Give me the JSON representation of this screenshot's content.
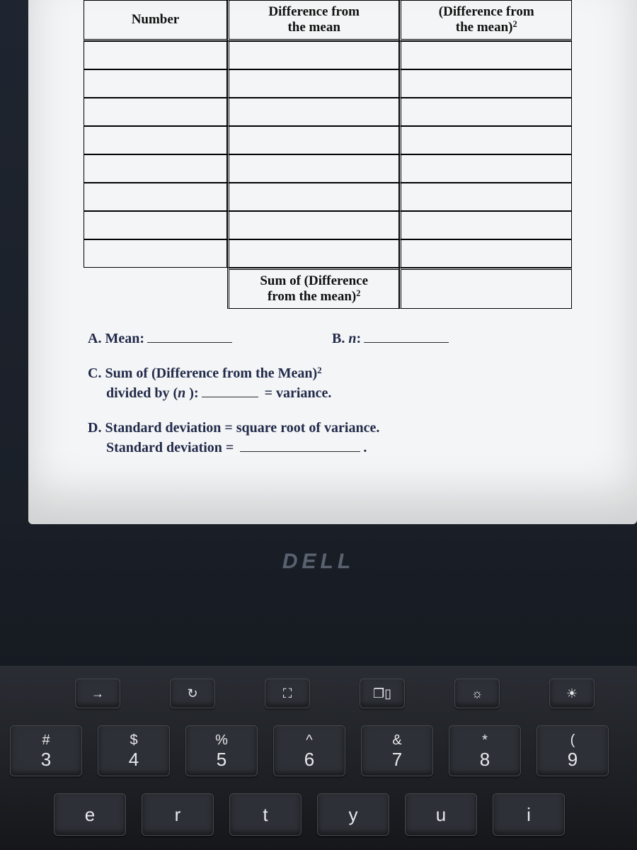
{
  "table": {
    "headers": {
      "number": "Number",
      "diff_line1": "Difference from",
      "diff_line2": "the mean",
      "sq_line1": "(Difference from",
      "sq_line2": "the mean)",
      "sq_sup": "2"
    },
    "row_count": 8,
    "sum_label_line1": "Sum of (Difference",
    "sum_label_line2": "from the mean)",
    "sum_label_sup": "2"
  },
  "prompts": {
    "a_label": "A.  Mean:",
    "b_label": "B.  ",
    "b_italic": "n",
    "b_colon": ":",
    "c_line1a": "C. Sum of (Difference from the Mean)",
    "c_sup": "2",
    "c_line2a": "divided by (",
    "c_line2_italic": "n",
    "c_line2b": " ):",
    "c_tail": "= variance.",
    "d_line1": "D. Standard deviation = square root of variance.",
    "d_line2": "Standard deviation =",
    "d_period": "."
  },
  "brand": "DELL",
  "keyboard": {
    "fn_row": [
      {
        "name": "arrow-right-icon",
        "glyph": "→"
      },
      {
        "name": "refresh-icon",
        "glyph": "↻"
      },
      {
        "name": "fullscreen-icon",
        "glyph": "⛶"
      },
      {
        "name": "overview-icon",
        "glyph": "❐▯"
      },
      {
        "name": "brightness-down-icon",
        "glyph": "☼"
      },
      {
        "name": "brightness-up-icon",
        "glyph": "☀"
      }
    ],
    "num_row": [
      {
        "sym": "#",
        "digit": "3",
        "name": "key-3"
      },
      {
        "sym": "$",
        "digit": "4",
        "name": "key-4"
      },
      {
        "sym": "%",
        "digit": "5",
        "name": "key-5"
      },
      {
        "sym": "^",
        "digit": "6",
        "name": "key-6"
      },
      {
        "sym": "&",
        "digit": "7",
        "name": "key-7"
      },
      {
        "sym": "*",
        "digit": "8",
        "name": "key-8"
      },
      {
        "sym": "(",
        "digit": "9",
        "name": "key-9"
      }
    ],
    "alpha_row": [
      {
        "label": "e",
        "name": "key-e"
      },
      {
        "label": "r",
        "name": "key-r"
      },
      {
        "label": "t",
        "name": "key-t"
      },
      {
        "label": "y",
        "name": "key-y"
      },
      {
        "label": "u",
        "name": "key-u"
      },
      {
        "label": "i",
        "name": "key-i"
      }
    ]
  }
}
